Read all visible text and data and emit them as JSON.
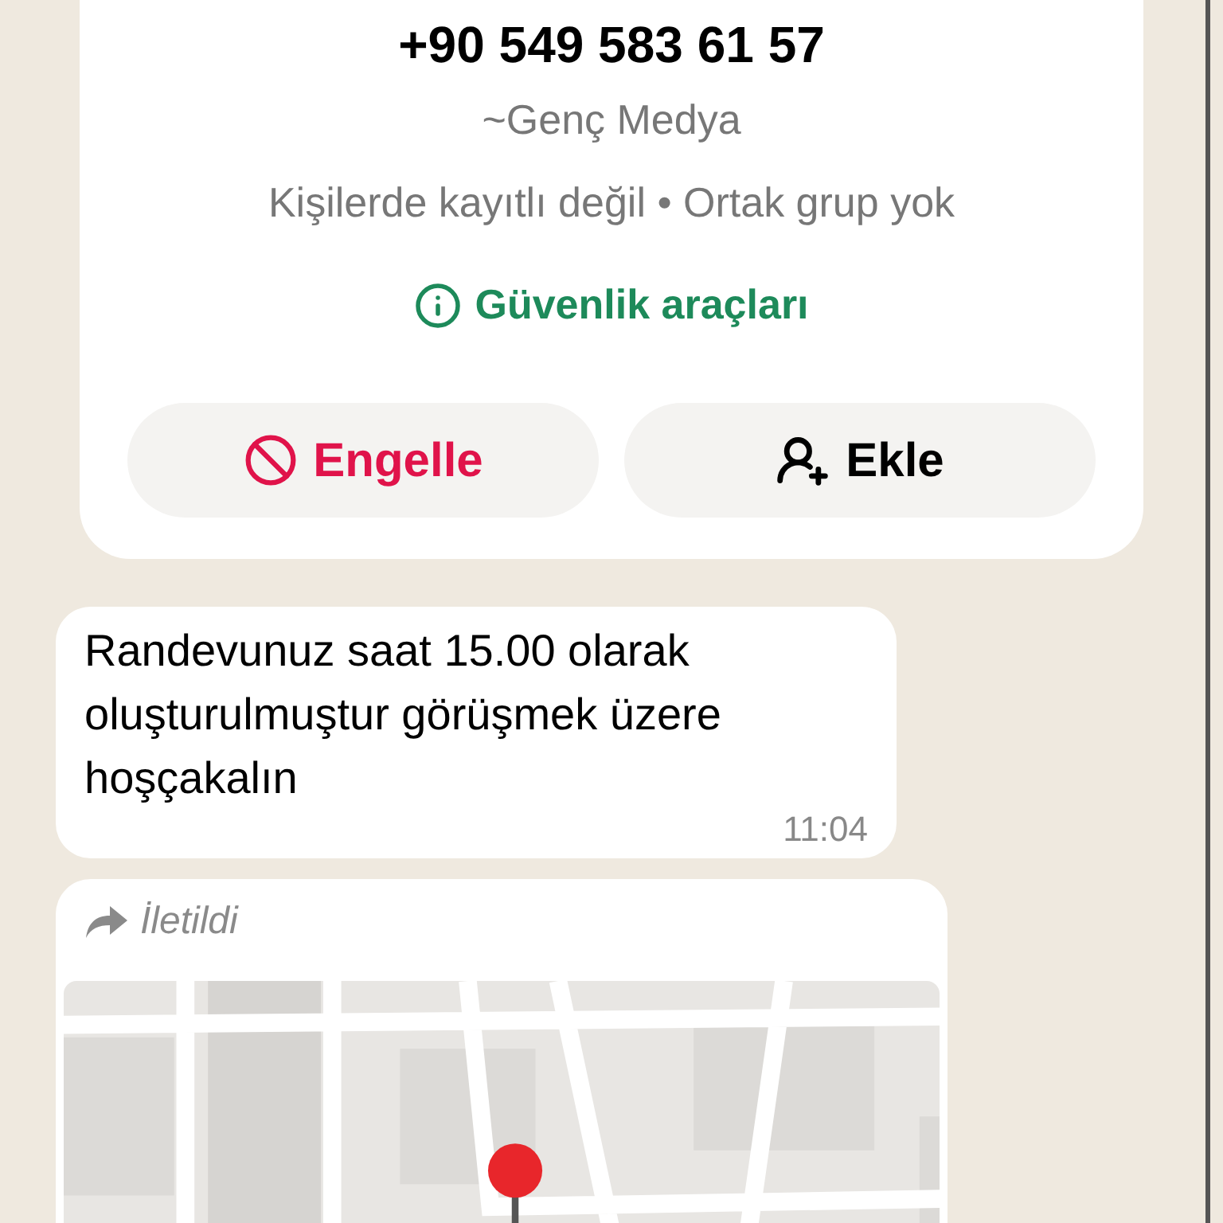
{
  "contact_card": {
    "phone": "+90 549 583 61 57",
    "name": "~Genç Medya",
    "info": "Kişilerde kayıtlı değil • Ortak grup yok",
    "safety_link": "Güvenlik araçları",
    "buttons": [
      {
        "kind": "block",
        "label": "Engelle"
      },
      {
        "kind": "add",
        "label": "Ekle"
      }
    ]
  },
  "messages": [
    {
      "kind": "text",
      "text": "Randevunuz saat 15.00 olarak oluşturulmuştur görüşmek üzere hoşçakalın",
      "time": "11:04"
    },
    {
      "kind": "location",
      "forwarded_label": "İletildi"
    }
  ]
}
